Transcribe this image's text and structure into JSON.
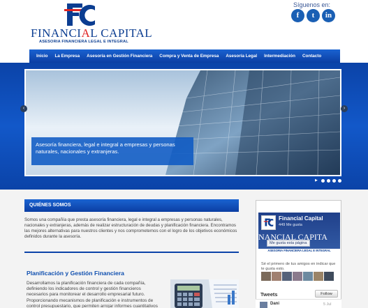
{
  "header": {
    "brand_part1": "FINANCI",
    "brand_part2": "A",
    "brand_part3": "L CAPITAL",
    "tagline": "ASESORIA FINANCIERA LEGAL E INTEGRAL",
    "social_title": "Síguenos en:",
    "social": [
      "f",
      "t",
      "in"
    ]
  },
  "nav": {
    "items": [
      "Inicio",
      "La Empresa",
      "Asesoría en Gestión Financiera",
      "Compra y Venta de Empresa",
      "Asesoría Legal",
      "Intermediación",
      "Contacto"
    ]
  },
  "slider": {
    "caption": "Asesoría financiera, legal e integral a empresas y personas naturales, nacionales y extranjeras.",
    "arrow_left": "‹",
    "arrow_right": "›",
    "play_symbol": "▶"
  },
  "about": {
    "heading": "QUIÉNES SOMOS",
    "text": "Somos una compañía que presta asesoría financiera, legal e integral a empresas y personas naturales, nacionales y extranjeras, además de realizar estructuración de deudas y planificación financiera. Encontramos las mejores alternativas para nuestros clientes y nos comprometemos con el logro de los objetivos económicos definidos durante la asesoría."
  },
  "planning": {
    "title": "Planificación y Gestión Financiera",
    "text": "Desarrollamos la planificación financiera de cada compañía, definiendo los indicadores de control y gestión financieros necesarios para monitorear el desarrollo empresarial futuro. Proporcionando mecanismos de planificación e instrumentos de control presupuestario, que permiten arrojar informes cuantitativos"
  },
  "facebook": {
    "page_name": "Financial Capital",
    "likes": "449 Me gusta",
    "big_name": "NANCIAL CAPITA",
    "like_button": "Me gusta esta página",
    "tag": "ASESORIA FINANCIERA LEGAL E INTEGRAL",
    "friends_text": "Sé el primero de tus amigos en indicar que te gusta esto."
  },
  "twitter": {
    "label": "Tweets",
    "follow": "Follow",
    "name": "Dani",
    "date": "5 Jul"
  },
  "colors": {
    "primary": "#0b43a8",
    "accent_red": "#e02424",
    "brand_blue": "#0b3d91"
  }
}
